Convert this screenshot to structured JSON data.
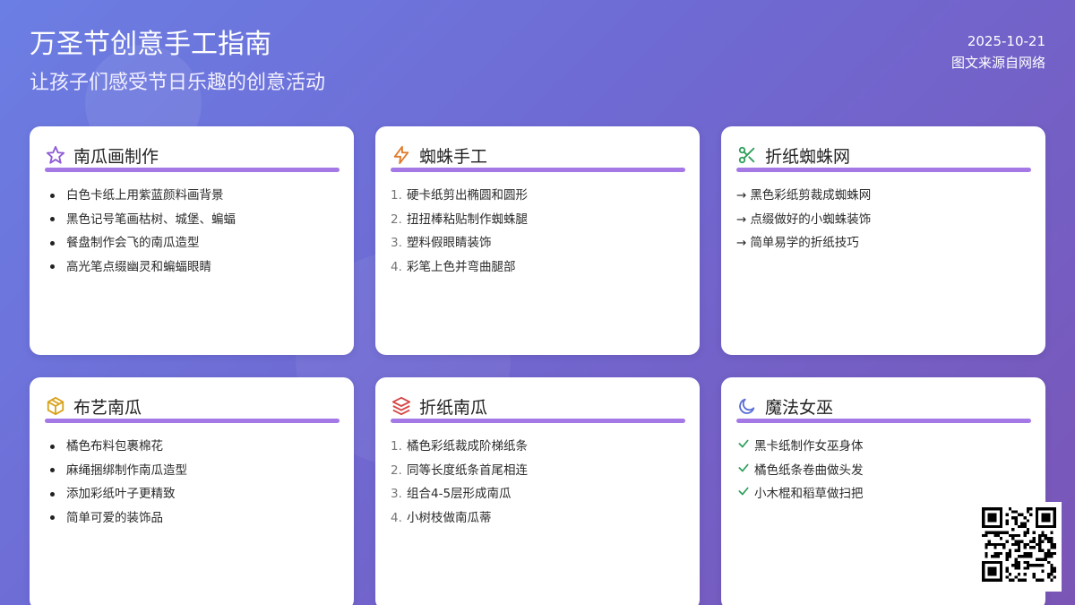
{
  "header": {
    "title": "万圣节创意手工指南",
    "subtitle": "让孩子们感受节日乐趣的创意活动",
    "date": "2025-10-21",
    "source": "图文来源自网络"
  },
  "cards": [
    {
      "title": "南瓜画制作",
      "icon": "star-icon",
      "list_style": "bullet",
      "items": [
        "白色卡纸上用紫蓝颜料画背景",
        "黑色记号笔画枯树、城堡、蝙蝠",
        "餐盘制作会飞的南瓜造型",
        "高光笔点缀幽灵和蝙蝠眼睛"
      ]
    },
    {
      "title": "蜘蛛手工",
      "icon": "lightning-icon",
      "list_style": "numbered",
      "items": [
        "硬卡纸剪出椭圆和圆形",
        "扭扭棒粘贴制作蜘蛛腿",
        "塑料假眼睛装饰",
        "彩笔上色并弯曲腿部"
      ],
      "numbers": [
        "1.",
        "2.",
        "3.",
        "4."
      ]
    },
    {
      "title": "折纸蜘蛛网",
      "icon": "scissors-icon",
      "list_style": "arrow",
      "items": [
        "黑色彩纸剪裁成蜘蛛网",
        "点缀做好的小蜘蛛装饰",
        "简单易学的折纸技巧"
      ],
      "marker": "→"
    },
    {
      "title": "布艺南瓜",
      "icon": "box-icon",
      "list_style": "bullet",
      "items": [
        "橘色布料包裹棉花",
        "麻绳捆绑制作南瓜造型",
        "添加彩纸叶子更精致",
        "简单可爱的装饰品"
      ]
    },
    {
      "title": "折纸南瓜",
      "icon": "layers-icon",
      "list_style": "numbered",
      "items": [
        "橘色彩纸裁成阶梯纸条",
        "同等长度纸条首尾相连",
        "组合4-5层形成南瓜",
        "小树枝做南瓜蒂"
      ],
      "numbers": [
        "1.",
        "2.",
        "3.",
        "4."
      ]
    },
    {
      "title": "魔法女巫",
      "icon": "moon-icon",
      "list_style": "check",
      "items": [
        "黑卡纸制作女巫身体",
        "橘色纸条卷曲做头发",
        "小木棍和稻草做扫把"
      ]
    }
  ],
  "colors": {
    "accent_bar": "#a479e6",
    "star": "#8e5ad6",
    "lightning": "#e07a2a",
    "scissors": "#2e9e5b",
    "box": "#d9a21c",
    "layers": "#d64545",
    "moon": "#5b6fd6",
    "check": "#2e9e5b"
  }
}
